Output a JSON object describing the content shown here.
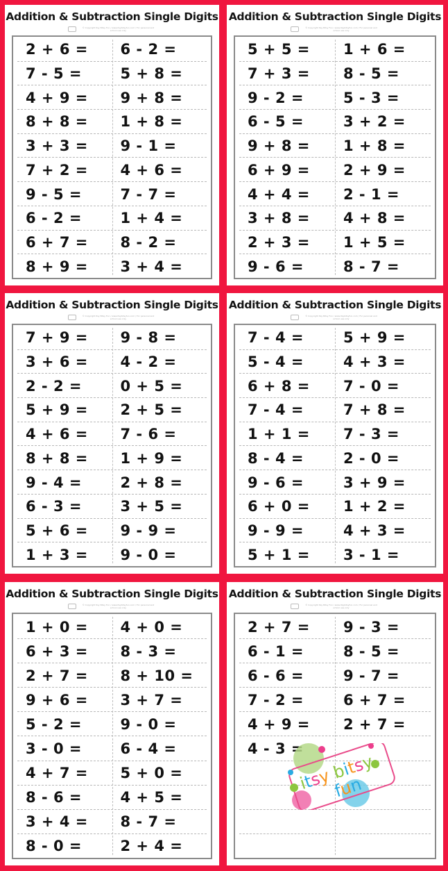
{
  "accent_color": "#f0163f",
  "worksheets": [
    {
      "title": "Addition & Subtraction Single Digits",
      "copyright": "© Copyright Itsy Bitsy Fun / www.itsybitsyfun.com / For personal and school use only",
      "left": [
        "2 + 6 =",
        "7 - 5 =",
        "4 + 9 =",
        "8 + 8 =",
        "3 + 3 =",
        "7 + 2 =",
        "9 - 5 =",
        "6 - 2 =",
        "6 + 7 =",
        "8 + 9 ="
      ],
      "right": [
        "6 - 2 =",
        "5 + 8 =",
        "9 + 8 =",
        "1 + 8 =",
        "9 - 1 =",
        "4 + 6 =",
        "7 - 7 =",
        "1 + 4 =",
        "8 - 2 =",
        "3 + 4 ="
      ]
    },
    {
      "title": "Addition & Subtraction Single Digits",
      "copyright": "© Copyright Itsy Bitsy Fun / www.itsybitsyfun.com / For personal and school use only",
      "left": [
        "5 + 5 =",
        "7 + 3 =",
        "9 - 2 =",
        "6 - 5 =",
        "9 + 8 =",
        "6 + 9 =",
        "4 + 4 =",
        "3 + 8 =",
        "2 + 3 =",
        "9 - 6 ="
      ],
      "right": [
        "1 + 6 =",
        "8 - 5 =",
        "5 - 3 =",
        "3 + 2 =",
        "1 + 8 =",
        "2 + 9 =",
        "2 - 1 =",
        "4 + 8 =",
        "1 + 5 =",
        "8 - 7 ="
      ]
    },
    {
      "title": "Addition & Subtraction Single Digits",
      "copyright": "© Copyright Itsy Bitsy Fun / www.itsybitsyfun.com / For personal and school use only",
      "left": [
        "7 + 9 =",
        "3 + 6 =",
        "2 - 2 =",
        "5 + 9 =",
        "4 + 6 =",
        "8 + 8 =",
        "9 - 4 =",
        "6 - 3 =",
        "5 + 6 =",
        "1 + 3 ="
      ],
      "right": [
        "9 - 8 =",
        "4 - 2 =",
        "0 + 5 =",
        "2 + 5 =",
        "7 - 6 =",
        "1 + 9 =",
        "2 + 8 =",
        "3 + 5 =",
        "9 - 9 =",
        "9 - 0 ="
      ]
    },
    {
      "title": "Addition & Subtraction Single Digits",
      "copyright": "© Copyright Itsy Bitsy Fun / www.itsybitsyfun.com / For personal and school use only",
      "left": [
        "7 - 4 =",
        "5 - 4 =",
        "6 + 8 =",
        "7 - 4 =",
        "1 + 1 =",
        "8 - 4 =",
        "9 - 6 =",
        "6 + 0 =",
        "9 - 9 =",
        "5 + 1 ="
      ],
      "right": [
        "5 + 9 =",
        "4 + 3 =",
        "7 - 0 =",
        "7 + 8 =",
        "7 - 3 =",
        "2 - 0 =",
        "3 + 9 =",
        "1 + 2 =",
        "4 + 3 =",
        "3 - 1 ="
      ]
    },
    {
      "title": "Addition & Subtraction Single Digits",
      "copyright": "© Copyright Itsy Bitsy Fun / www.itsybitsyfun.com / For personal and school use only",
      "left": [
        "1 + 0 =",
        "6 + 3 =",
        "2 + 7 =",
        "9 + 6 =",
        "5 - 2 =",
        "3 - 0 =",
        "4 + 7 =",
        "8 - 6 =",
        "3 + 4 =",
        "8 - 0 ="
      ],
      "right": [
        "4 + 0 =",
        "8 - 3 =",
        "8 + 10 =",
        "3 + 7 =",
        "9 - 0 =",
        "6 - 4 =",
        "5 + 0 =",
        "4 + 5 =",
        "8 - 7 =",
        "2 + 4 ="
      ]
    },
    {
      "title": "Addition & Subtraction Single Digits",
      "copyright": "© Copyright Itsy Bitsy Fun / www.itsybitsyfun.com / For personal and school use only",
      "left": [
        "2 + 7 =",
        "6 - 1 =",
        "6 - 6 =",
        "7 - 2 =",
        "4 + 9 =",
        "4 - 3 =",
        "",
        "",
        "",
        ""
      ],
      "right": [
        "9 - 3 =",
        "8 - 5 =",
        "9 - 7 =",
        "6 + 7 =",
        "2 + 7 =",
        "",
        "",
        "",
        "",
        ""
      ],
      "watermark": {
        "line1": "itsy bitsy",
        "line2": "fun",
        "colors": [
          "#8cc63f",
          "#f7941d",
          "#29abe2",
          "#ec3e8c",
          "#f7941d"
        ]
      }
    }
  ]
}
